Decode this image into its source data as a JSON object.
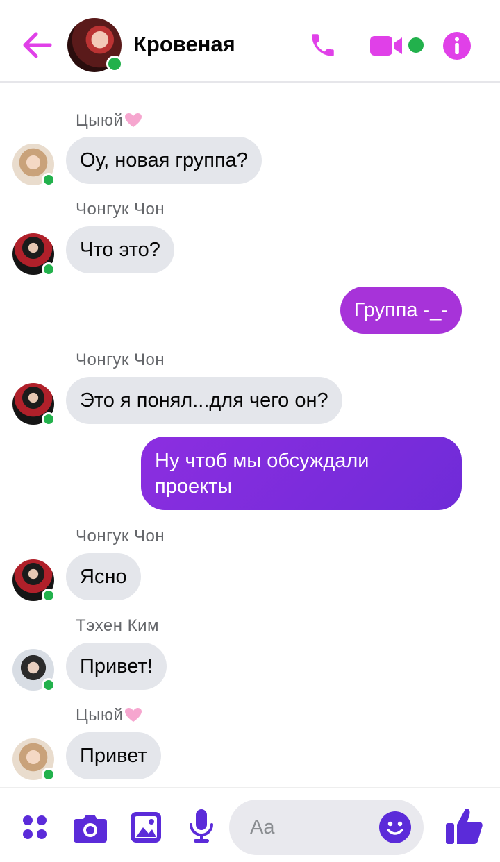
{
  "header": {
    "title": "Кровеная",
    "colors": {
      "accent": "#e040e8",
      "online": "#22b14c"
    }
  },
  "messages": [
    {
      "sender": "Цыюй",
      "text": "Оу, новая группа?",
      "side": "in"
    },
    {
      "sender": "Чонгук Чон",
      "text": "Что это?",
      "side": "in"
    },
    {
      "text": "Группа -_-",
      "side": "out"
    },
    {
      "sender": "Чонгук Чон",
      "text": "Это я понял...для чего он?",
      "side": "in"
    },
    {
      "text": "Ну чтоб мы обсуждали проекты",
      "side": "out"
    },
    {
      "sender": "Чонгук Чон",
      "text": "Ясно",
      "side": "in"
    },
    {
      "sender": "Тэхен Ким",
      "text": "Привет!",
      "side": "in"
    },
    {
      "sender": "Цыюй",
      "text": "Привет",
      "side": "in"
    }
  ],
  "composer": {
    "placeholder": "Aa",
    "icons": [
      "grid-menu-icon",
      "camera-icon",
      "image-icon",
      "microphone-icon",
      "emoji-icon",
      "thumbs-up-icon"
    ],
    "color": "#5b2bd9"
  }
}
